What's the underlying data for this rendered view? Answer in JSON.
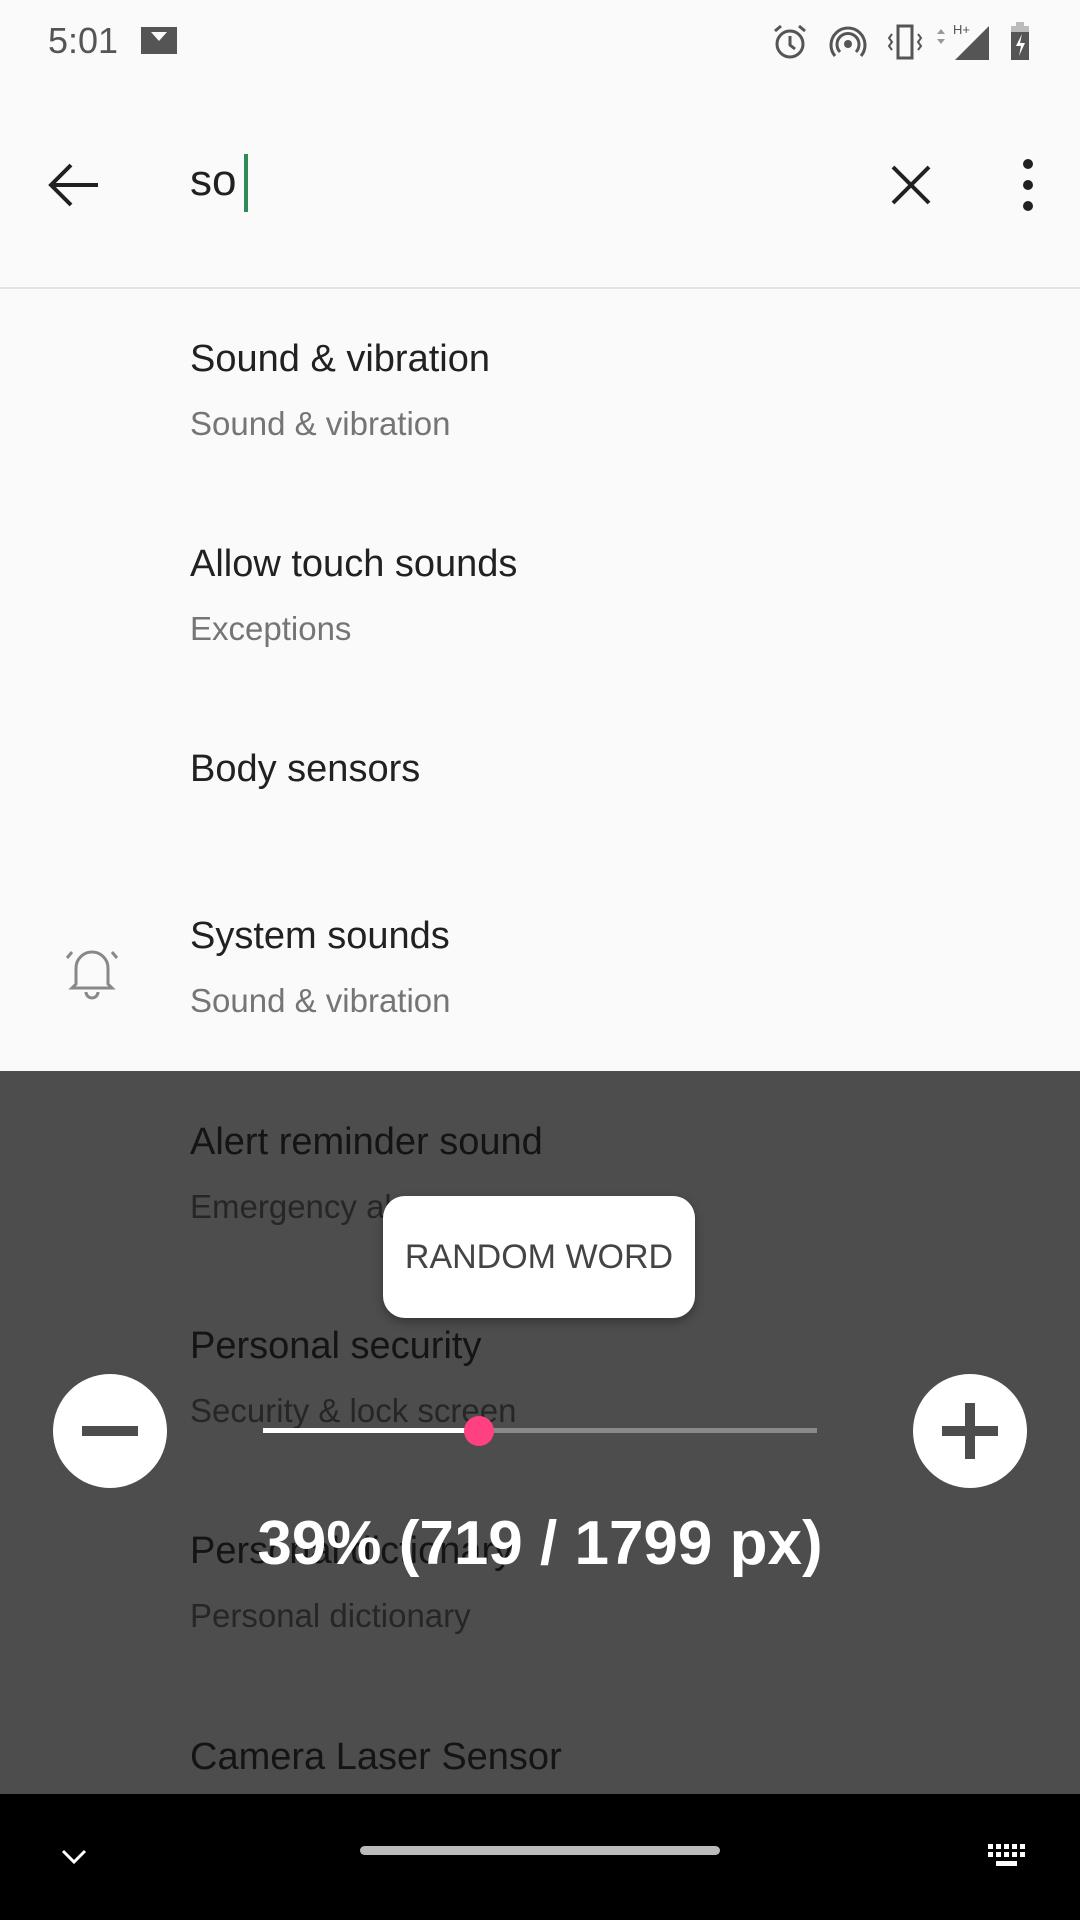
{
  "status_bar": {
    "time": "5:01",
    "icons": [
      "mail-icon",
      "alarm-icon",
      "hotspot-icon",
      "vibrate-icon",
      "signal-h-plus-icon",
      "battery-charging-icon"
    ]
  },
  "toolbar": {
    "query": "so",
    "back_icon": "arrow-left-icon",
    "clear_icon": "close-icon",
    "menu_icon": "more-vert-icon"
  },
  "results": [
    {
      "title": "Sound & vibration",
      "subtitle": "Sound & vibration"
    },
    {
      "title": "Allow touch sounds",
      "subtitle": "Exceptions"
    },
    {
      "title": "Body sensors",
      "subtitle": ""
    },
    {
      "title": "System sounds",
      "subtitle": "Sound & vibration",
      "icon": "bell-icon"
    },
    {
      "title": "Alert reminder sound",
      "subtitle": "Emergency alerts"
    },
    {
      "title": "Personal security",
      "subtitle": "Security & lock screen"
    },
    {
      "title": "Personal dictionary",
      "subtitle": "Personal dictionary"
    },
    {
      "title": "Camera Laser Sensor",
      "subtitle": ""
    }
  ],
  "overlay": {
    "popup_label": "RANDOM WORD",
    "scroll_percent": 39,
    "scroll_text": "39% (719 / 1799 px)",
    "accent": "#ff4081"
  },
  "nav": {
    "left_icon": "chevron-down-icon",
    "right_icon": "keyboard-icon"
  }
}
